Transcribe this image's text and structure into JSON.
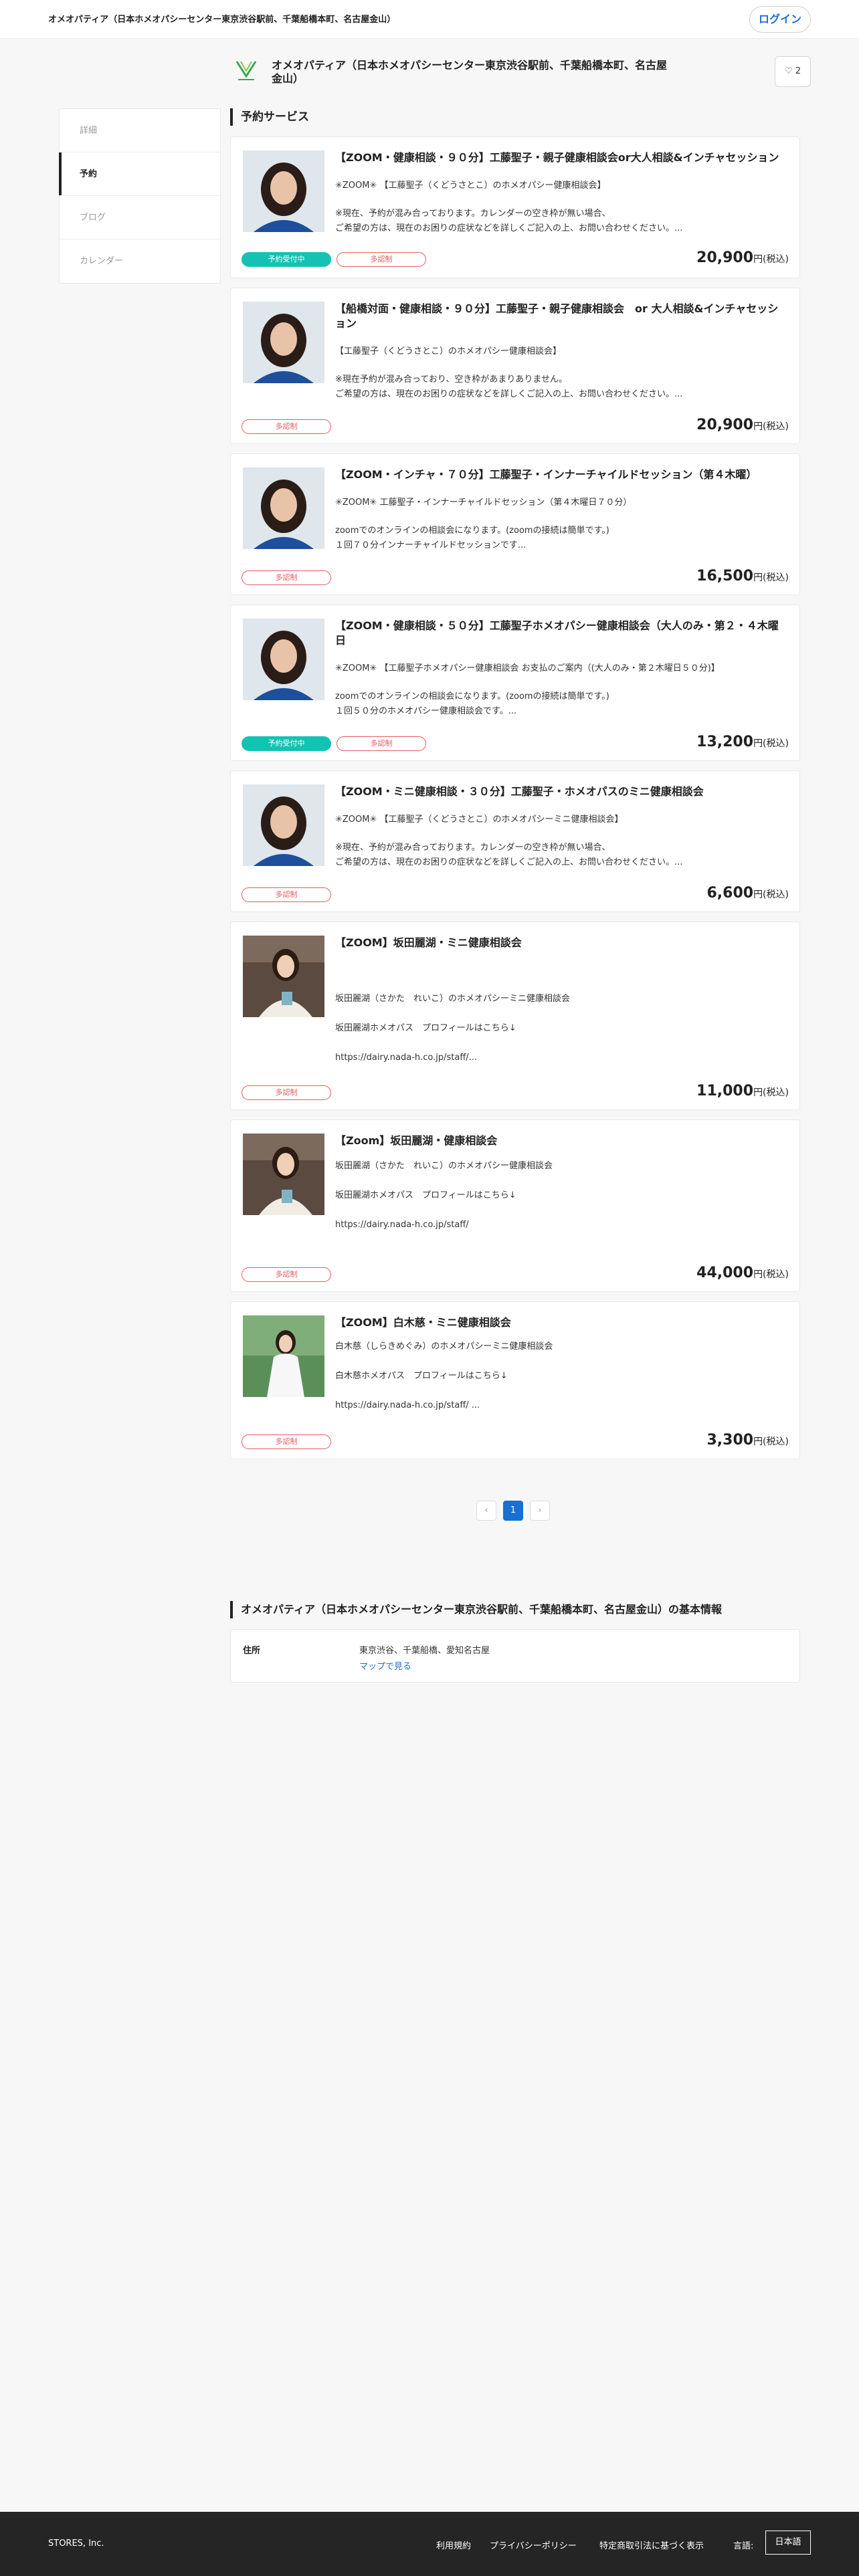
{
  "header": {
    "store_name": "オメオパティア（日本ホメオパシーセンター東京渋谷駅前、千葉船橋本町、名古屋金山）",
    "login_label": "ログイン"
  },
  "store": {
    "title": "オメオパティア（日本ホメオパシーセンター東京渋谷駅前、千葉船橋本町、名古屋金山）",
    "favorite_count": "2"
  },
  "sidebar": {
    "items": [
      {
        "label": "詳細",
        "active": false
      },
      {
        "label": "予約",
        "active": true
      },
      {
        "label": "ブログ",
        "active": false
      },
      {
        "label": "カレンダー",
        "active": false
      }
    ]
  },
  "main": {
    "section_title": "予約サービス",
    "badge_available": "予約受付中",
    "badge_multi": "多認制",
    "price_unit": "円(税込)",
    "services": [
      {
        "title": "【ZOOM・健康相談・９０分】工藤聖子・親子健康相談会or大人相談&インチャセッション",
        "sub": "✳︎ZOOM✳︎ 【工藤聖子（くどうさとこ）のホメオパシー健康相談会】",
        "desc": "※現在、予約が混み合っております。カレンダーの空き枠が無い場合、\nご希望の方は、現在のお困りの症状などを詳しくご記入の上、お問い合わせください。...",
        "price": "20,900",
        "available": true
      },
      {
        "title": "【船橋対面・健康相談・９０分】工藤聖子・親子健康相談会　or 大人相談&インチャセッション",
        "sub": "【工藤聖子（くどうさとこ）のホメオパシー健康相談会】",
        "desc": "※現在予約が混み合っており、空き枠があまりありません。\nご希望の方は、現在のお困りの症状などを詳しくご記入の上、お問い合わせください。...",
        "price": "20,900",
        "available": false
      },
      {
        "title": "【ZOOM・インチャ・７０分】工藤聖子・インナーチャイルドセッション（第４木曜）",
        "sub": "✳︎ZOOM✳︎ 工藤聖子・インナーチャイルドセッション（第４木曜日７０分）",
        "desc": "zoomでのオンラインの相談会になります。(zoomの接続は簡単です。)\n１回７０分インナーチャイルドセッションです...",
        "price": "16,500",
        "available": false
      },
      {
        "title": "【ZOOM・健康相談・５０分】工藤聖子ホメオパシー健康相談会（大人のみ・第２・４木曜日",
        "sub": "✳︎ZOOM✳︎ 【工藤聖子ホメオパシー健康相談会 お支払のご案内（(大人のみ・第２木曜日５０分)】",
        "desc": "zoomでのオンラインの相談会になります。(zoomの接続は簡単です。)\n１回５０分のホメオパシー健康相談会です。...",
        "price": "13,200",
        "available": true
      },
      {
        "title": "【ZOOM・ミニ健康相談・３０分】工藤聖子・ホメオパスのミニ健康相談会",
        "sub": "✳︎ZOOM✳︎ 【工藤聖子（くどうさとこ）のホメオパシーミニ健康相談会】",
        "desc": "※現在、予約が混み合っております。カレンダーの空き枠が無い場合、\nご希望の方は、現在のお困りの症状などを詳しくご記入の上、お問い合わせください。...",
        "price": "6,600",
        "available": false
      },
      {
        "title": "【ZOOM】坂田麗湖・ミニ健康相談会",
        "sub": "",
        "desc": "坂田麗湖（さかた　れいこ）のホメオパシーミニ健康相談会\n\n坂田麗湖ホメオパス　プロフィールはこちら↓\n\nhttps://dairy.nada-h.co.jp/staff/...",
        "price": "11,000",
        "available": false
      },
      {
        "title": "【Zoom】坂田麗湖・健康相談会",
        "sub": "",
        "desc": "坂田麗湖（さかた　れいこ）のホメオパシー健康相談会\n\n坂田麗湖ホメオパス　プロフィールはこちら↓\n\nhttps://dairy.nada-h.co.jp/staff/",
        "price": "44,000",
        "available": false
      },
      {
        "title": "【ZOOM】白木慈・ミニ健康相談会",
        "sub": "",
        "desc": "白木慈（しらきめぐみ）のホメオパシーミニ健康相談会\n\n白木慈ホメオパス　プロフィールはこちら↓\n\nhttps://dairy.nada-h.co.jp/staff/ ...",
        "price": "3,300",
        "available": false
      }
    ]
  },
  "pagination": {
    "prev": "‹",
    "current": "1",
    "next": "›"
  },
  "info": {
    "title": "オメオパティア（日本ホメオパシーセンター東京渋谷駅前、千葉船橋本町、名古屋金山）の基本情報",
    "address_label": "住所",
    "address_value": "東京渋谷、千葉船橋、愛知名古屋",
    "map_link": "マップで見る"
  },
  "footer": {
    "company": "STORES, Inc.",
    "links": [
      "利用規約",
      "プライバシーポリシー",
      "特定商取引法に基づく表示"
    ],
    "lang_label": "言語:",
    "lang_value": "日本語"
  },
  "colors": {
    "accent": "#1a6fd1",
    "available": "#13c2b3",
    "multi": "#e45c5c",
    "footer_bg": "#252525"
  }
}
